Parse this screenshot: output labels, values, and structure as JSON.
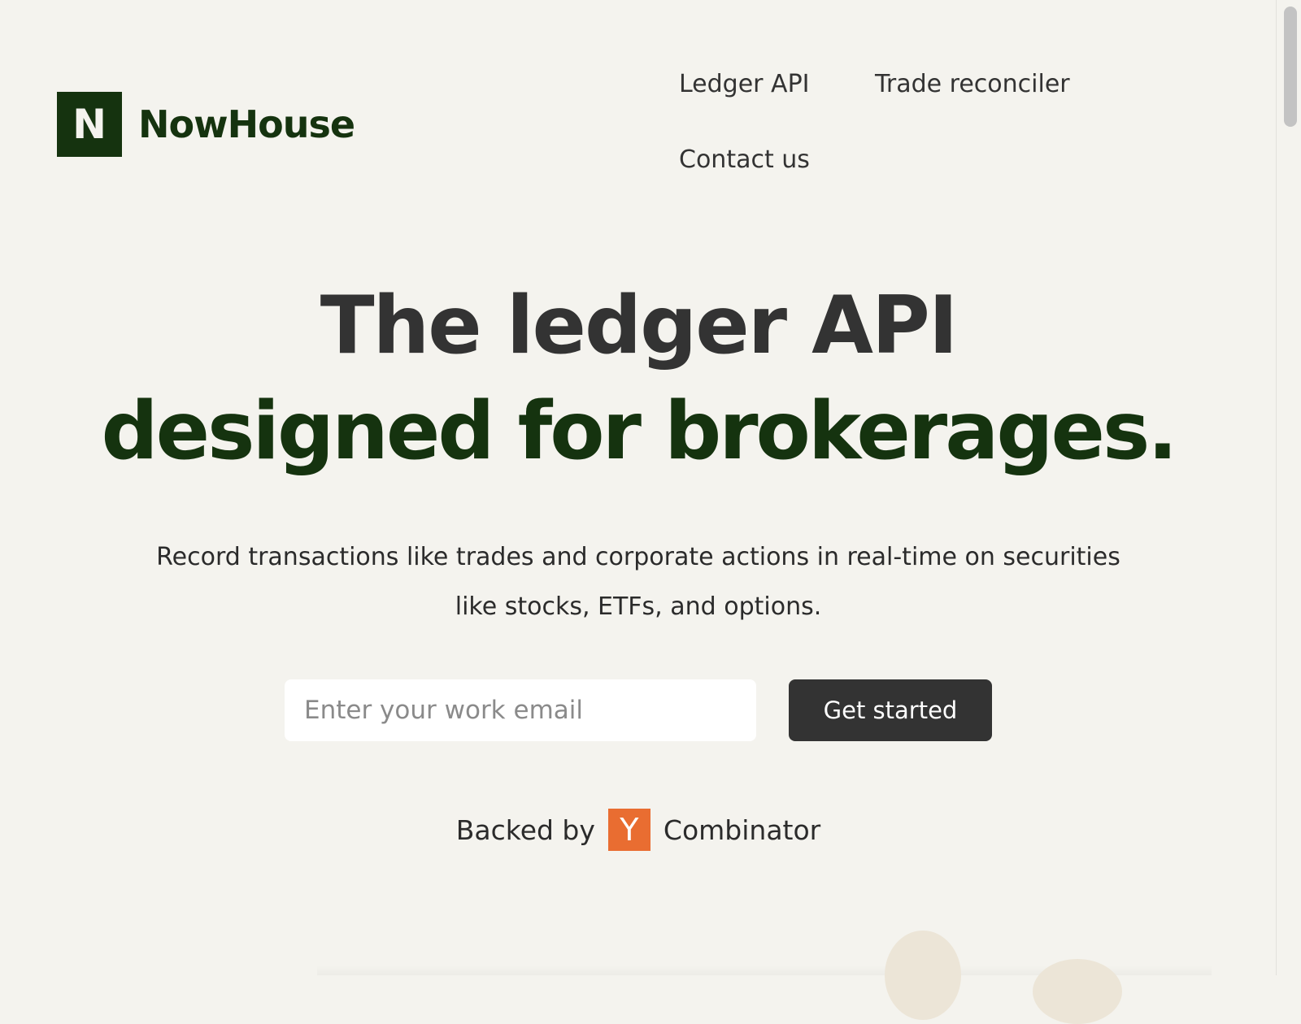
{
  "brand": {
    "mark_letter": "N",
    "name": "NowHouse"
  },
  "nav": {
    "items": [
      {
        "label": "Ledger API"
      },
      {
        "label": "Trade reconciler"
      },
      {
        "label": "Contact us"
      }
    ]
  },
  "hero": {
    "title_line1": "The ledger API",
    "title_line2": "designed for brokerages.",
    "subtitle": "Record transactions like trades and corporate actions in real-time on securities like stocks, ETFs, and options."
  },
  "signup": {
    "email_placeholder": "Enter your work email",
    "email_value": "",
    "button_label": "Get started"
  },
  "backed_by": {
    "prefix": "Backed by",
    "logo_letter": "Y",
    "suffix": "Combinator"
  },
  "colors": {
    "background": "#f4f3ee",
    "brand_green": "#15330f",
    "text_dark": "#333333",
    "button_bg": "#333333",
    "yc_orange": "#e96d31"
  }
}
